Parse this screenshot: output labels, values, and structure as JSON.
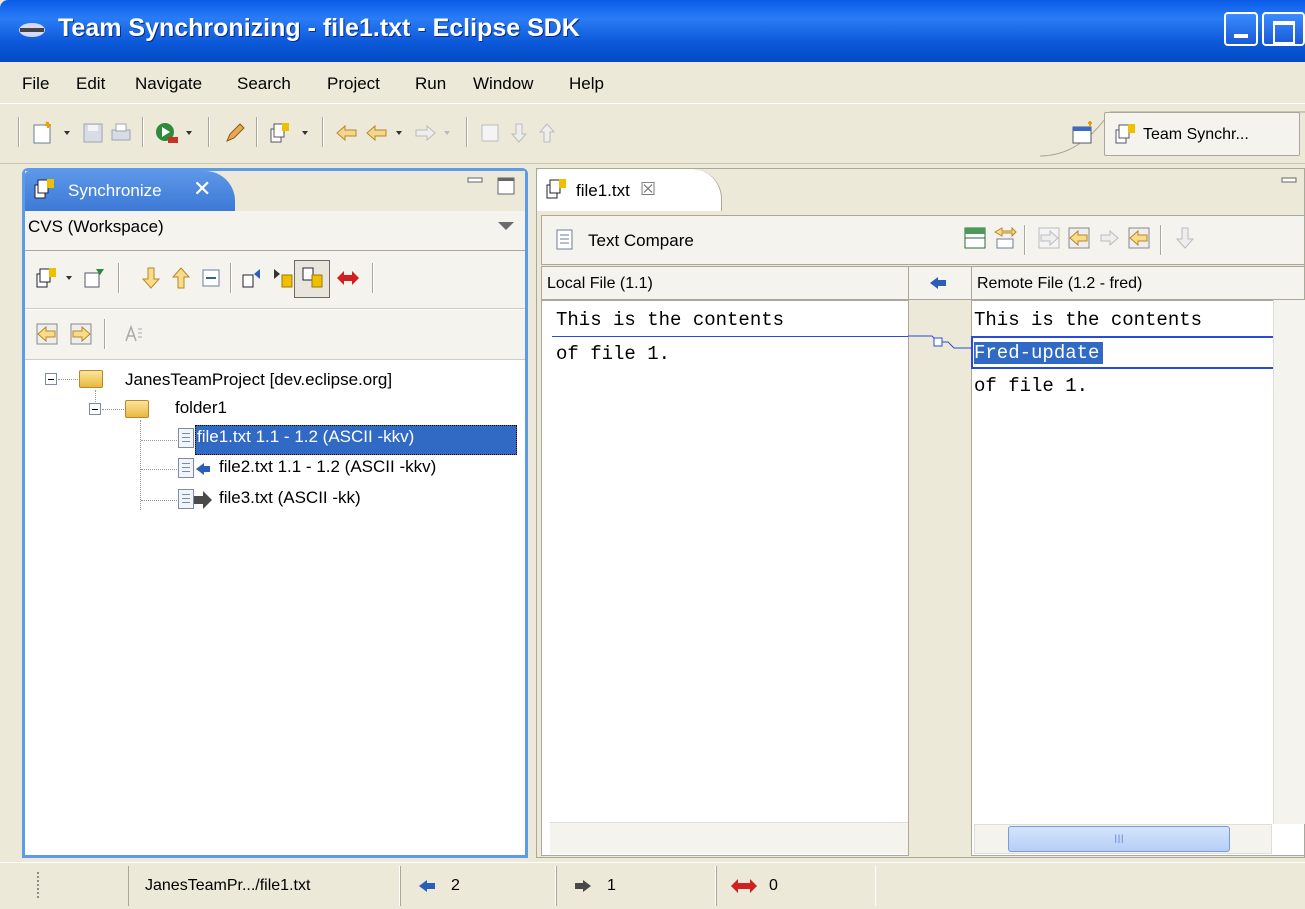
{
  "window": {
    "title": "Team Synchronizing - file1.txt - Eclipse SDK"
  },
  "menu": [
    "File",
    "Edit",
    "Navigate",
    "Search",
    "Project",
    "Run",
    "Window",
    "Help"
  ],
  "perspective": {
    "label": "Team Synchr..."
  },
  "left_view": {
    "tab_label": "Synchronize",
    "close_glyph": "✕",
    "scope_label": "CVS (Workspace)",
    "tree": [
      {
        "label": "JanesTeamProject  [dev.eclipse.org]",
        "type": "project"
      },
      {
        "label": "folder1",
        "type": "folder"
      },
      {
        "label": "file1.txt  1.1 - 1.2  (ASCII -kkv)",
        "type": "incoming",
        "selected": true
      },
      {
        "label": "file2.txt  1.1 - 1.2  (ASCII -kkv)",
        "type": "incoming"
      },
      {
        "label": "file3.txt    (ASCII -kk)",
        "type": "outgoing"
      }
    ]
  },
  "editor": {
    "tab_label": "file1.txt",
    "close_glyph": "☒",
    "compare_title": "Text Compare",
    "local": {
      "header": "Local File (1.1)",
      "lines": [
        "This is the contents",
        "of file 1."
      ]
    },
    "remote": {
      "header": "Remote File (1.2 - fred)",
      "lines": [
        "This is the contents",
        "Fred-update",
        "of file 1."
      ]
    },
    "scroll_thumb_glyph": "III"
  },
  "status_bar": {
    "path": "JanesTeamPr.../file1.txt",
    "incoming_count": "2",
    "outgoing_count": "1",
    "conflict_count": "0"
  },
  "colors": {
    "accent": "#316ac5",
    "titlebar": "#0a5be8",
    "conflict": "#d02020"
  }
}
